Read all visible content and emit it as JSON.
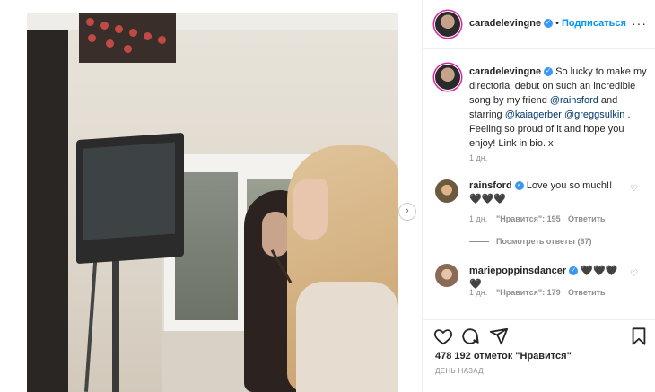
{
  "post": {
    "author": "caradelevingne",
    "follow_label": "Подписаться",
    "caption_text": "So lucky to make my directorial debut on such an incredible song by my friend",
    "mention_1": "@rainsford",
    "caption_mid": "and starring",
    "mention_2": "@kaiagerber",
    "mention_3": "@greggsulkin",
    "caption_end": ". Feeling so proud of it and hope you enjoy! Link in bio. x",
    "time": "1 дн."
  },
  "comments": [
    {
      "username": "rainsford",
      "text": "Love you so much!! 🖤🖤🖤",
      "time": "1 дн.",
      "likes": "\"Нравится\": 195",
      "reply_label": "Ответить",
      "view_replies": "Посмотреть ответы (67)"
    },
    {
      "username": "mariepoppinsdancer",
      "text": "🖤🖤🖤🖤",
      "time": "1 дн.",
      "likes": "\"Нравится\": 179",
      "reply_label": "Ответить"
    }
  ],
  "footer": {
    "likes_text": "478 192 отметок \"Нравится\"",
    "posted_ago": "ДЕНЬ НАЗАД"
  },
  "icons": {
    "heart": "heart-icon",
    "comment": "comment-icon",
    "share": "share-icon",
    "save": "bookmark-icon",
    "next": "chevron-right-icon",
    "more": "more-icon"
  },
  "colors": {
    "accent": "#0095f6",
    "verified": "#3897f0",
    "muted": "#8e8e8e",
    "text": "#262626"
  }
}
